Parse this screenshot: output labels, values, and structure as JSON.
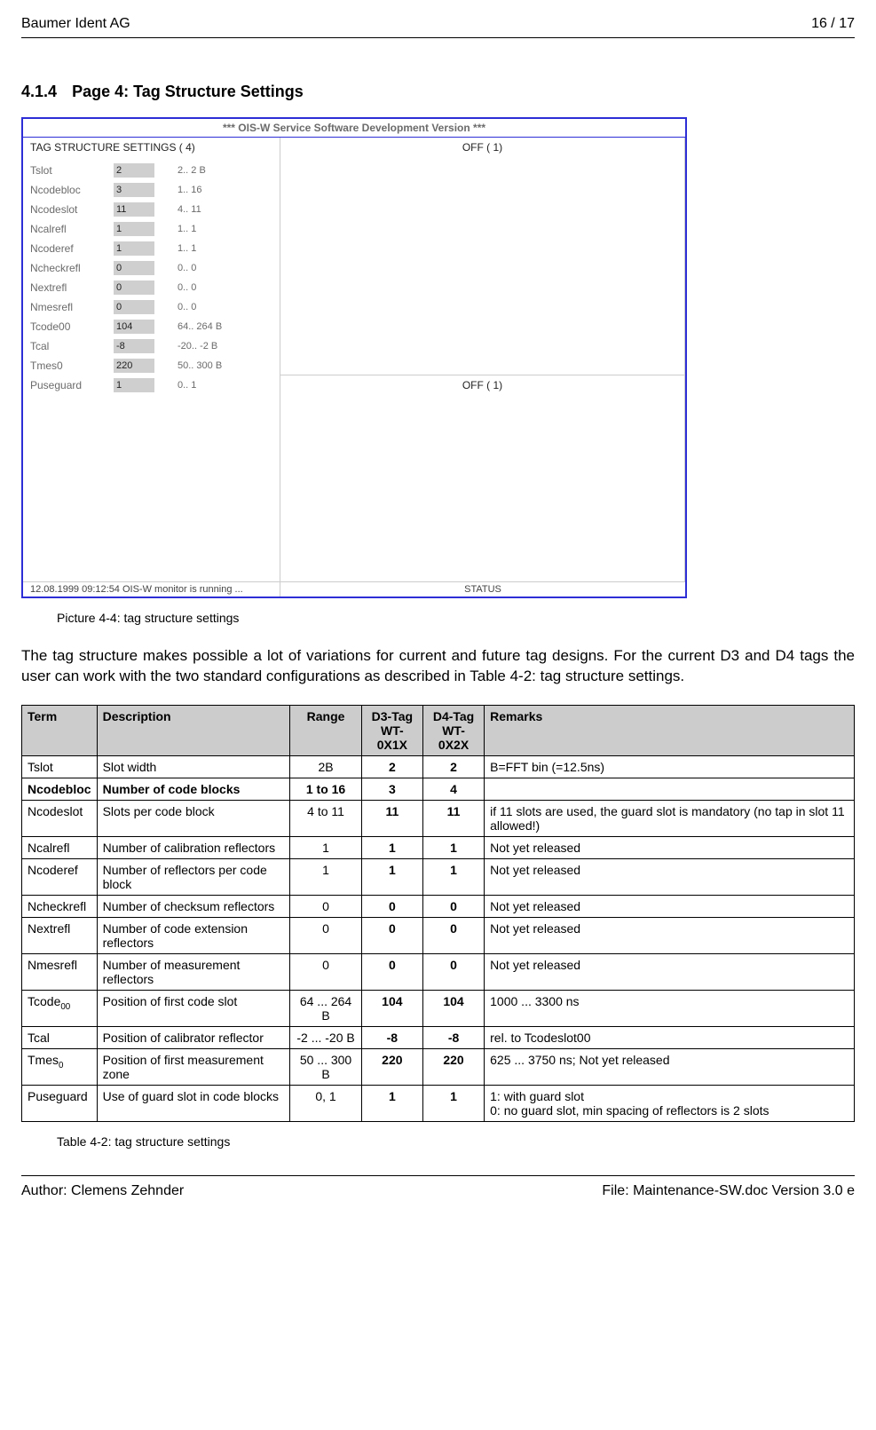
{
  "header": {
    "left": "Baumer Ident AG",
    "right": "16 / 17"
  },
  "section": {
    "number": "4.1.4",
    "title": "Page 4: Tag Structure Settings"
  },
  "figure": {
    "banner": "*** OIS-W Service Software Development Version ***",
    "left_title": "TAG STRUCTURE SETTINGS ( 4)",
    "off_label": "OFF ( 1)",
    "rows": [
      {
        "label": "Tslot",
        "value": "2",
        "range": "2..   2 B"
      },
      {
        "label": "Ncodebloc",
        "value": "3",
        "range": "1..  16"
      },
      {
        "label": "Ncodeslot",
        "value": "11",
        "range": "4..  11"
      },
      {
        "label": "Ncalrefl",
        "value": "1",
        "range": "1..   1"
      },
      {
        "label": "Ncoderef",
        "value": "1",
        "range": "1..   1"
      },
      {
        "label": "Ncheckrefl",
        "value": "0",
        "range": "0..   0"
      },
      {
        "label": "Nextrefl",
        "value": "0",
        "range": "0..   0"
      },
      {
        "label": "Nmesrefl",
        "value": "0",
        "range": "0..   0"
      },
      {
        "label": "Tcode00",
        "value": "104",
        "range": "64.. 264 B"
      },
      {
        "label": "Tcal",
        "value": "-8",
        "range": "-20..  -2 B"
      },
      {
        "label": "Tmes0",
        "value": "220",
        "range": "50.. 300 B"
      },
      {
        "label": "Puseguard",
        "value": "1",
        "range": "0..   1"
      }
    ],
    "status_stamp": "12.08.1999  09:12:54    OIS-W monitor is running ...",
    "status_label": "STATUS"
  },
  "caption_fig": "Picture 4-4: tag structure settings",
  "paragraph": "The tag structure makes possible a lot of variations for current and future tag designs. For the current D3 and D4 tags the user can work with the two standard configurations as described in Table 4-2: tag structure settings.",
  "table": {
    "headers": {
      "term": "Term",
      "desc": "Description",
      "range": "Range",
      "d3a": "D3-Tag",
      "d3b": "WT-0X1X",
      "d4a": "D4-Tag",
      "d4b": "WT-0X2X",
      "rem": "Remarks"
    },
    "rows": [
      {
        "term": "Tslot",
        "desc": "Slot width",
        "range": "2B",
        "d3": "2",
        "d4": "2",
        "rem": "B=FFT bin (=12.5ns)",
        "bold": false
      },
      {
        "term": "Ncodebloc",
        "desc": "Number of code blocks",
        "range": "1 to 16",
        "d3": "3",
        "d4": "4",
        "rem": "",
        "bold": true
      },
      {
        "term": "Ncodeslot",
        "desc": "Slots per code block",
        "range": "4 to 11",
        "d3": "11",
        "d4": "11",
        "rem": "if 11 slots are used, the guard slot is mandatory (no tap in slot 11 allowed!)",
        "bold": false
      },
      {
        "term": "Ncalrefl",
        "desc": "Number of calibration reflectors",
        "range": "1",
        "d3": "1",
        "d4": "1",
        "rem": "Not yet released",
        "bold": false
      },
      {
        "term": "Ncoderef",
        "desc": "Number of reflectors per code block",
        "range": "1",
        "d3": "1",
        "d4": "1",
        "rem": "Not yet released",
        "bold": false
      },
      {
        "term": "Ncheckrefl",
        "desc": "Number of checksum reflectors",
        "range": "0",
        "d3": "0",
        "d4": "0",
        "rem": "Not yet released",
        "bold": false
      },
      {
        "term": "Nextrefl",
        "desc": "Number of code extension reflectors",
        "range": "0",
        "d3": "0",
        "d4": "0",
        "rem": "Not yet released",
        "bold": false
      },
      {
        "term": "Nmesrefl",
        "desc": "Number of measurement reflectors",
        "range": "0",
        "d3": "0",
        "d4": "0",
        "rem": "Not yet released",
        "bold": false
      },
      {
        "term_html": "Tcode<sub>00</sub>",
        "term": "Tcode00",
        "desc": "Position of first code slot",
        "range": "64 ... 264 B",
        "d3": "104",
        "d4": "104",
        "rem": "1000 ... 3300 ns",
        "bold": false
      },
      {
        "term": "Tcal",
        "desc": "Position of calibrator reflector",
        "range": "-2 ... -20 B",
        "d3": "-8",
        "d4": "-8",
        "rem": "rel. to Tcodeslot00",
        "bold": false
      },
      {
        "term_html": "Tmes<sub>0</sub>",
        "term": "Tmes0",
        "desc": "Position of first measurement zone",
        "range": "50 ... 300 B",
        "d3": "220",
        "d4": "220",
        "rem": "625 ... 3750 ns; Not yet released",
        "bold": false
      },
      {
        "term": "Puseguard",
        "desc": "Use of guard slot in code blocks",
        "range": "0, 1",
        "d3": "1",
        "d4": "1",
        "rem": "1: with guard slot\n0: no guard slot, min spacing of reflectors is 2 slots",
        "bold": false
      }
    ]
  },
  "caption_tbl": "Table 4-2: tag structure settings",
  "footer": {
    "left": "Author: Clemens Zehnder",
    "right": "File: Maintenance-SW.doc Version 3.0 e"
  }
}
